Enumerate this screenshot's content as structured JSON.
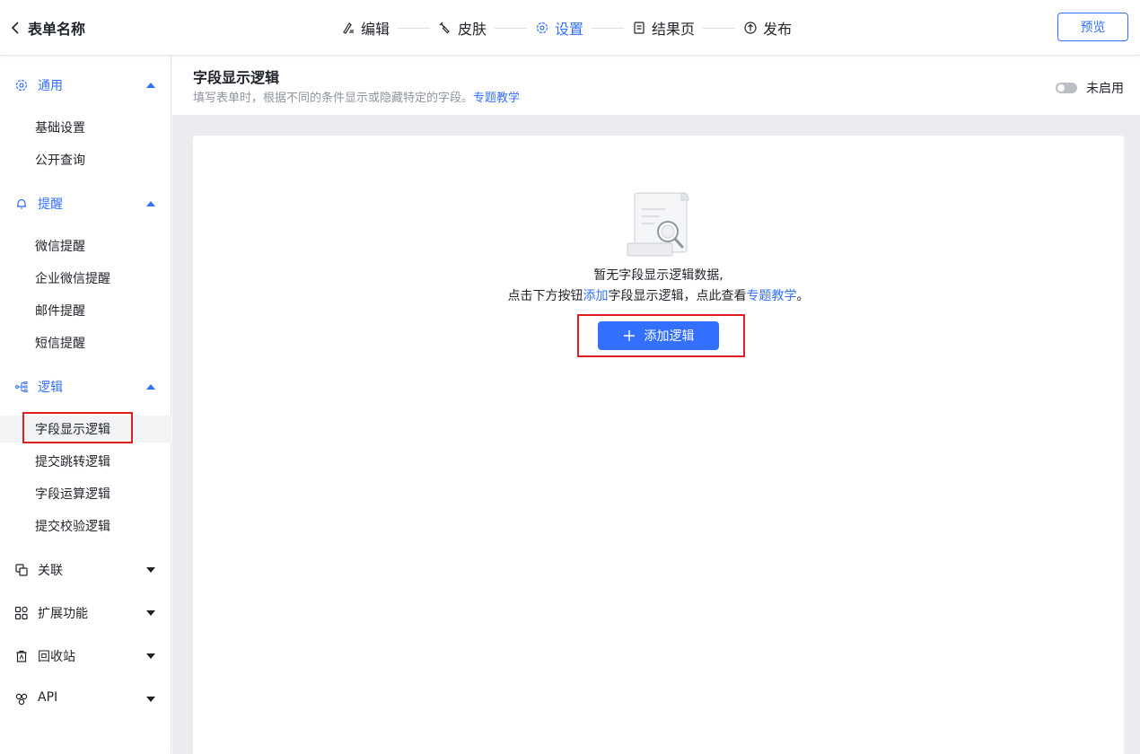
{
  "header": {
    "title": "表单名称",
    "steps": [
      {
        "label": "编辑",
        "icon": "edit-icon"
      },
      {
        "label": "皮肤",
        "icon": "brush-icon"
      },
      {
        "label": "设置",
        "icon": "gear-icon",
        "active": true
      },
      {
        "label": "结果页",
        "icon": "document-icon"
      },
      {
        "label": "发布",
        "icon": "publish-icon"
      }
    ],
    "preview_label": "预览"
  },
  "sidebar": {
    "groups": [
      {
        "label": "通用",
        "icon": "gear-icon",
        "expanded": true,
        "items": [
          "基础设置",
          "公开查询"
        ]
      },
      {
        "label": "提醒",
        "icon": "bell-icon",
        "expanded": true,
        "items": [
          "微信提醒",
          "企业微信提醒",
          "邮件提醒",
          "短信提醒"
        ]
      },
      {
        "label": "逻辑",
        "icon": "logic-tree-icon",
        "expanded": true,
        "items": [
          "字段显示逻辑",
          "提交跳转逻辑",
          "字段运算逻辑",
          "提交校验逻辑"
        ],
        "selected_item": "字段显示逻辑"
      },
      {
        "label": "关联",
        "icon": "link-icon",
        "expanded": false
      },
      {
        "label": "扩展功能",
        "icon": "grid-icon",
        "expanded": false
      },
      {
        "label": "回收站",
        "icon": "trash-icon",
        "expanded": false
      },
      {
        "label": "API",
        "icon": "api-icon",
        "expanded": false
      }
    ]
  },
  "main": {
    "title": "字段显示逻辑",
    "desc_text": "填写表单时，根据不同的条件显示或隐藏特定的字段。",
    "desc_link": "专题教学",
    "toggle_label": "未启用",
    "toggle_on": false,
    "empty": {
      "line1": "暂无字段显示逻辑数据,",
      "line2_a": "点击下方按钮",
      "line2_link1": "添加",
      "line2_b": "字段显示逻辑，点此查看",
      "line2_link2": "专题教学",
      "line2_c": "。",
      "add_button": "添加逻辑"
    }
  },
  "colors": {
    "accent": "#3370ff",
    "highlight": "#e02020",
    "text": "#1f2329",
    "muted": "#8f959e"
  }
}
